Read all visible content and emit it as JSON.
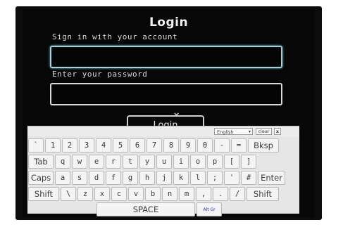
{
  "title": "Login",
  "username_label": "Sign in with your account",
  "password_label": "Enter your password",
  "username_value": "",
  "password_value": "",
  "close_glyph": "×",
  "login_button": "Login",
  "keyboard": {
    "language": "English",
    "language_arrow": "▾",
    "clear_label": "clear",
    "close_label": "x",
    "row1": [
      "`",
      "1",
      "2",
      "3",
      "4",
      "5",
      "6",
      "7",
      "8",
      "9",
      "0",
      "-",
      "=",
      "Bksp"
    ],
    "row2": [
      "Tab",
      "q",
      "w",
      "e",
      "r",
      "t",
      "y",
      "u",
      "i",
      "o",
      "p",
      "[",
      "]"
    ],
    "row3": [
      "Caps",
      "a",
      "s",
      "d",
      "f",
      "g",
      "h",
      "j",
      "k",
      "l",
      ";",
      "'",
      "#",
      "Enter"
    ],
    "row4": [
      "Shift",
      "\\",
      "z",
      "x",
      "c",
      "v",
      "b",
      "n",
      "m",
      ",",
      ".",
      "/",
      "Shift"
    ],
    "space_label": "SPACE",
    "altgr_label": "Alt Gr"
  }
}
